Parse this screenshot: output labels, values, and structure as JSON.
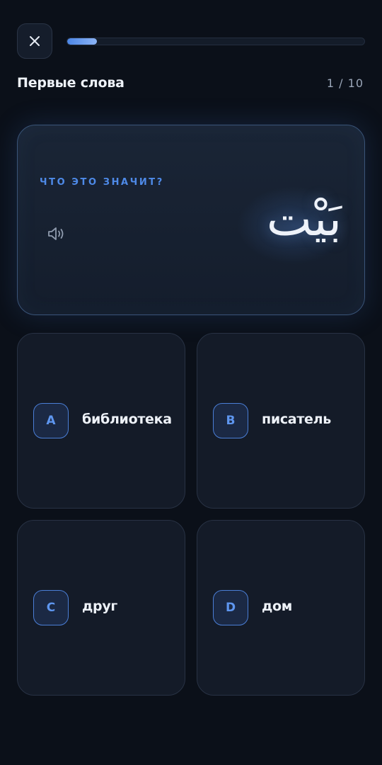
{
  "header": {
    "close_icon": "close-icon",
    "progress_fraction": 0.1,
    "title": "Первые слова",
    "counter": "1 / 10"
  },
  "question": {
    "prompt": "ЧТО ЭТО ЗНАЧИТ?",
    "audio_icon": "speaker-icon",
    "word": "بَيْت"
  },
  "options": [
    {
      "letter": "A",
      "label": "библиотека"
    },
    {
      "letter": "B",
      "label": "писатель"
    },
    {
      "letter": "C",
      "label": "друг"
    },
    {
      "letter": "D",
      "label": "дом"
    }
  ],
  "colors": {
    "background": "#0b1019",
    "accent": "#4e8ae8",
    "card": "#141b28"
  }
}
